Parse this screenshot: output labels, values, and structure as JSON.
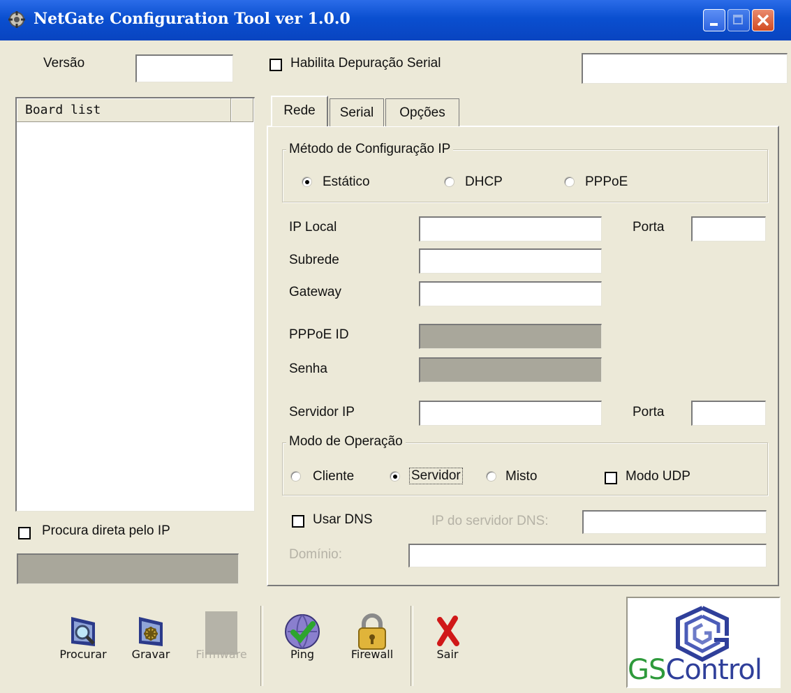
{
  "window": {
    "title": "NetGate Configuration Tool ver 1.0.0",
    "title_bar_color": "#0a58d8"
  },
  "top": {
    "version_label": "Versão",
    "version_value": "",
    "serial_debug_label": "Habilita Depuração Serial",
    "serial_debug_value": ""
  },
  "board_list": {
    "header": "Board list",
    "items": []
  },
  "direct_search": {
    "label": "Procura direta pelo IP",
    "value": ""
  },
  "tabs": [
    {
      "label": "Rede",
      "active": true
    },
    {
      "label": "Serial",
      "active": false
    },
    {
      "label": "Opções",
      "active": false
    }
  ],
  "ip_method": {
    "title": "Método de Configuração IP",
    "options": [
      "Estático",
      "DHCP",
      "PPPoE"
    ],
    "selected": "Estático"
  },
  "fields": {
    "ip_local": "IP Local",
    "porta": "Porta",
    "subrede": "Subrede",
    "gateway": "Gateway",
    "pppoe_id": "PPPoE ID",
    "senha": "Senha",
    "servidor_ip": "Servidor IP",
    "porta2": "Porta"
  },
  "op_mode": {
    "title": "Modo de Operação",
    "options": [
      "Cliente",
      "Servidor",
      "Misto"
    ],
    "selected": "Servidor",
    "udp_label": "Modo UDP"
  },
  "dns": {
    "use_label": "Usar DNS",
    "server_label": "IP do servidor DNS:",
    "domain_label": "Domínio:"
  },
  "toolbar": {
    "procurar": "Procurar",
    "gravar": "Gravar",
    "firmware": "Firmware",
    "ping": "Ping",
    "firewall": "Firewall",
    "sair": "Sair"
  },
  "logo": {
    "text_gs": "GS",
    "text_control": "Control",
    "color_blue": "#2f3f9a",
    "color_green": "#2e9a3b"
  }
}
